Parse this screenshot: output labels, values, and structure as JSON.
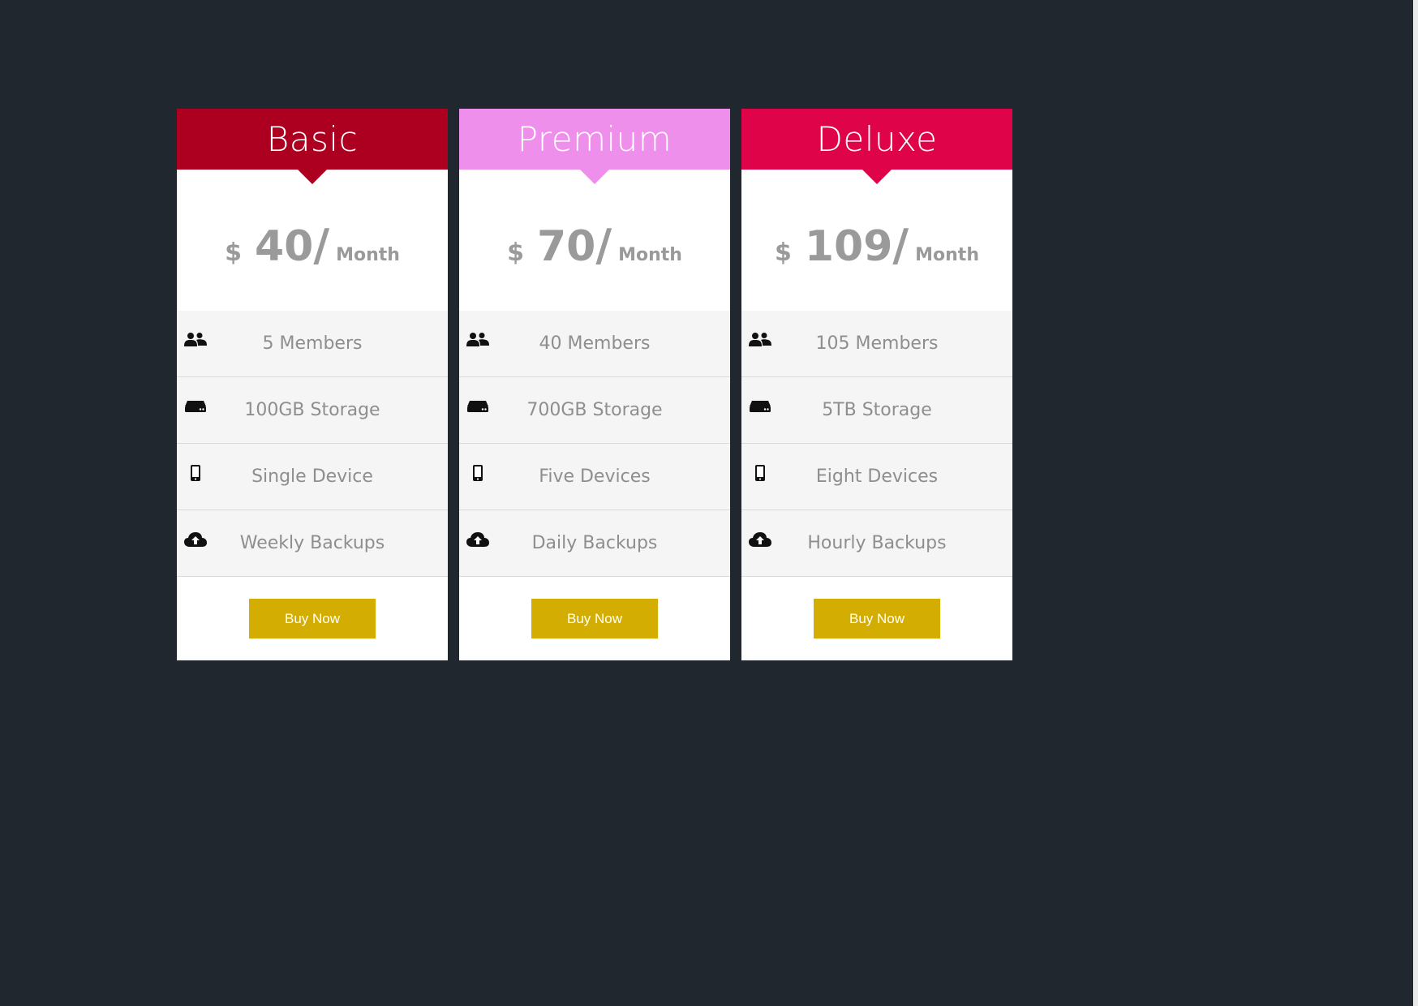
{
  "colors": {
    "background": "#21272f",
    "card": "#ffffff",
    "feature_row": "#f5f5f5",
    "button": "#d4ad03",
    "basic_header": "#ad0020",
    "premium_header": "#ef8fec",
    "deluxe_header": "#df0349"
  },
  "icons": {
    "members": "users-icon",
    "storage": "hard-drive-icon",
    "devices": "mobile-phone-icon",
    "backups": "cloud-upload-icon"
  },
  "plans": [
    {
      "name": "Basic",
      "currency": "$",
      "amount": "40",
      "slash": "/",
      "period": "Month",
      "features": [
        "5 Members",
        "100GB Storage",
        "Single Device",
        "Weekly Backups"
      ],
      "button_label": "Buy Now"
    },
    {
      "name": "Premium",
      "currency": "$",
      "amount": "70",
      "slash": "/",
      "period": "Month",
      "features": [
        "40 Members",
        "700GB Storage",
        "Five Devices",
        "Daily Backups"
      ],
      "button_label": "Buy Now"
    },
    {
      "name": "Deluxe",
      "currency": "$",
      "amount": "109",
      "slash": "/",
      "period": "Month",
      "features": [
        "105 Members",
        "5TB Storage",
        "Eight Devices",
        "Hourly Backups"
      ],
      "button_label": "Buy Now"
    }
  ]
}
